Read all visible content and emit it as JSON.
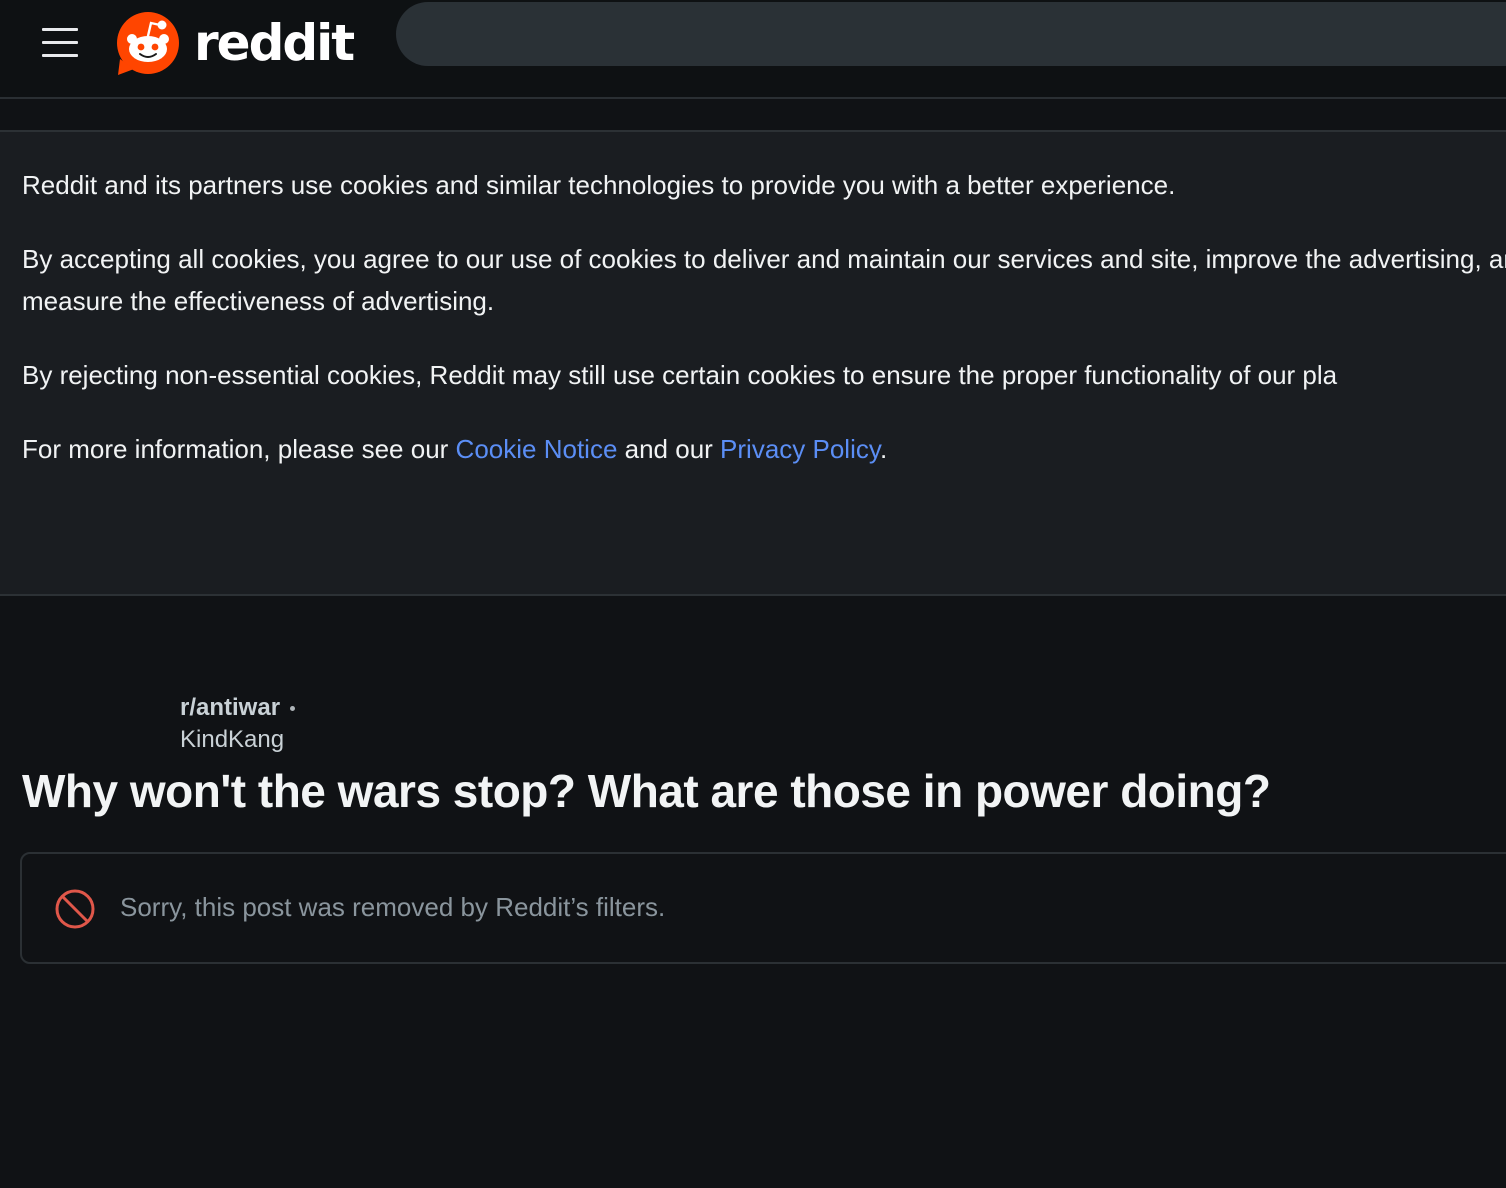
{
  "header": {
    "menu_icon": "hamburger-menu-icon",
    "logo_icon": "reddit-snoo-icon",
    "logo_text": "reddit",
    "search_placeholder": ""
  },
  "cookie_banner": {
    "paragraph1": "Reddit and its partners use cookies and similar technologies to provide you with a better experience.",
    "paragraph2": "By accepting all cookies, you agree to our use of cookies to deliver and maintain our services and site, improve the advertising, and measure the effectiveness of advertising.",
    "paragraph3": "By rejecting non-essential cookies, Reddit may still use certain cookies to ensure the proper functionality of our pla",
    "paragraph4_prefix": "For more information, please see our ",
    "cookie_notice_link": "Cookie Notice",
    "paragraph4_middle": " and our ",
    "privacy_policy_link": "Privacy Policy",
    "paragraph4_suffix": "."
  },
  "post": {
    "subreddit": "r/antiwar",
    "author": "KindKang",
    "title": "Why won't the wars stop? What are those in power doing?",
    "removed_message": "Sorry, this post was removed by Reddit’s filters.",
    "removed_icon": "prohibited-icon"
  },
  "colors": {
    "background": "#101215",
    "banner_background": "#1a1d21",
    "link": "#5b8ef5",
    "reddit_orange": "#ff4500",
    "removed_icon": "#e0574a"
  }
}
